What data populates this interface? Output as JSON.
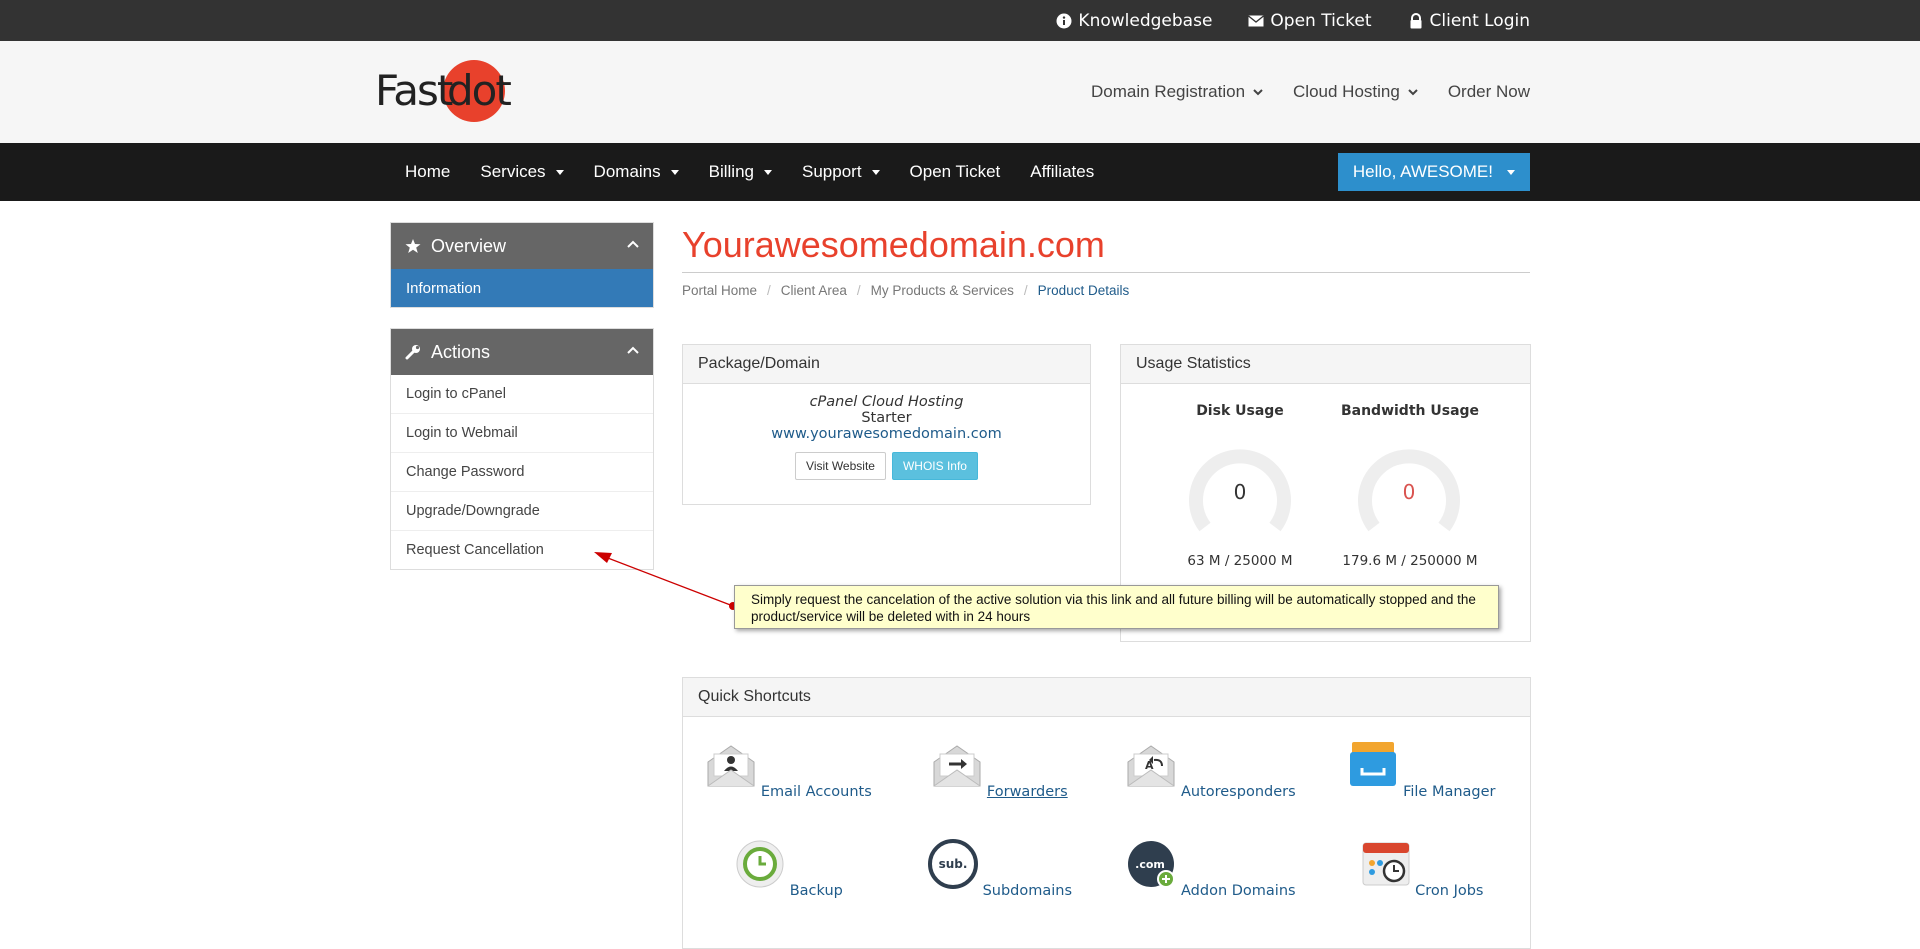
{
  "topbar": {
    "knowledgebase": "Knowledgebase",
    "open_ticket": "Open Ticket",
    "client_login": "Client Login"
  },
  "logo": {
    "part1": "Fast",
    "part2": "dot"
  },
  "header_nav": {
    "domain_registration": "Domain Registration",
    "cloud_hosting": "Cloud Hosting",
    "order_now": "Order Now"
  },
  "main_nav": {
    "home": "Home",
    "services": "Services",
    "domains": "Domains",
    "billing": "Billing",
    "support": "Support",
    "open_ticket": "Open Ticket",
    "affiliates": "Affiliates",
    "user_menu": "Hello, AWESOME!"
  },
  "sidebar": {
    "overview": {
      "title": "Overview",
      "items": [
        "Information"
      ]
    },
    "actions": {
      "title": "Actions",
      "items": [
        "Login to cPanel",
        "Login to Webmail",
        "Change Password",
        "Upgrade/Downgrade",
        "Request Cancellation"
      ]
    }
  },
  "page": {
    "title": "Yourawesomedomain.com",
    "breadcrumb": [
      "Portal Home",
      "Client Area",
      "My Products & Services",
      "Product Details"
    ]
  },
  "package": {
    "header": "Package/Domain",
    "product": "cPanel Cloud Hosting",
    "plan": "Starter",
    "domain": "www.yourawesomedomain.com",
    "visit_website": "Visit Website",
    "whois_info": "WHOIS Info"
  },
  "usage": {
    "header": "Usage Statistics",
    "disk": {
      "label": "Disk Usage",
      "value": "0",
      "numbers": "63 M / 25000 M",
      "color": "#333333"
    },
    "bandwidth": {
      "label": "Bandwidth Usage",
      "value": "0",
      "numbers": "179.6 M / 250000 M",
      "color": "#d9534f"
    }
  },
  "tooltip": {
    "text": "Simply request the cancelation of the active solution via this link and all future billing will be automatically stopped and the product/service will be deleted with in 24 hours"
  },
  "shortcuts": {
    "header": "Quick Shortcuts",
    "items": [
      "Email Accounts",
      "Forwarders",
      "Autoresponders",
      "File Manager",
      "Backup",
      "Subdomains",
      "Addon Domains",
      "Cron Jobs"
    ]
  },
  "colors": {
    "brand": "#e8412c",
    "primary": "#337ab7",
    "navbar": "#1a1a1a",
    "link": "#1f5b8a"
  }
}
